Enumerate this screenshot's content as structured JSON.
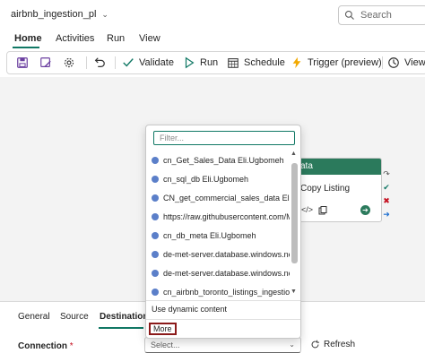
{
  "header": {
    "pipeline_name": "airbnb_ingestion_pl",
    "search_placeholder": "Search"
  },
  "tabs": [
    {
      "label": "Home",
      "active": true
    },
    {
      "label": "Activities"
    },
    {
      "label": "Run"
    },
    {
      "label": "View"
    }
  ],
  "toolbar": {
    "validate": "Validate",
    "run": "Run",
    "schedule": "Schedule",
    "trigger": "Trigger (preview)",
    "view": "View"
  },
  "activity": {
    "header_text": "ata",
    "name": "Copy Listing",
    "code_icon": "</>"
  },
  "dropdown": {
    "filter_placeholder": "Filter...",
    "items": [
      "cn_Get_Sales_Data Eli.Ugbomeh",
      "cn_sql_db Eli.Ugbomeh",
      "CN_get_commercial_sales_data Eli.Ug",
      "https://raw.githubusercontent.com/M",
      "cn_db_meta Eli.Ugbomeh",
      "de-met-server.database.windows.net",
      "de-met-server.database.windows.net",
      "cn_airbnb_toronto_listings_ingestion"
    ],
    "dynamic_content": "Use dynamic content",
    "more": "More"
  },
  "bottom_panel": {
    "tabs": [
      "General",
      "Source",
      "Destination"
    ],
    "connection_label": "Connection",
    "required_mark": "*",
    "select_placeholder": "Select...",
    "refresh": "Refresh"
  },
  "colors": {
    "accent": "#117865",
    "activity_header": "#2b7a5c",
    "highlight_border": "#8b1a1a"
  }
}
